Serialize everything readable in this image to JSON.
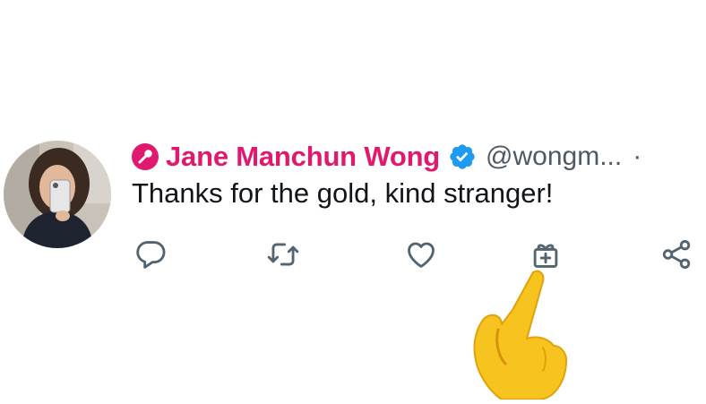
{
  "tweet": {
    "display_name": "Jane Manchun Wong",
    "handle": "@wongm...",
    "separator": "·",
    "text": "Thanks for the gold, kind stranger!"
  },
  "icons": {
    "name_badge": "microphone-icon",
    "verified": "verified-badge-icon",
    "reply": "reply-icon",
    "retweet": "retweet-icon",
    "like": "heart-icon",
    "gift": "gift-icon",
    "share": "share-icon",
    "pointer": "pointing-hand-emoji"
  },
  "colors": {
    "name": "#e0196f",
    "verified": "#1d9bf0",
    "icon": "#536471",
    "text": "#111418"
  }
}
